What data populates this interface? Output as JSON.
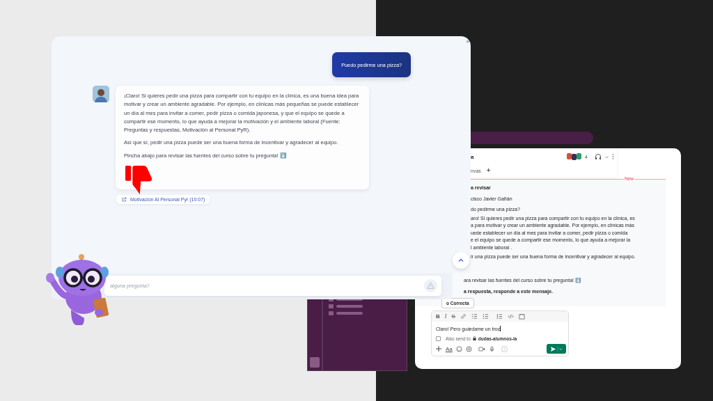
{
  "chat_window": {
    "close": "×",
    "messages": [
      {
        "kind": "user",
        "text": "Puedo pedirme una pizza?"
      },
      {
        "kind": "bot",
        "paragraphs": [
          "¡Claro! Si quieres pedir una pizza para compartir con tu equipo en la clínica, es una buena idea para motivar y crear un ambiente agradable. Por ejemplo, en clínicas más pequeñas se puede establecer un día al mes para invitar a comer, pedir pizza o comida japonesa, y que el equipo se quede a compartir ese momento, lo que ayuda a mejorar la motivación y el ambiente laboral (Fuente: Preguntas y respuestas, Motivación al Personal PyR).",
          "Así que sí, pedir una pizza puede ser una buena forma de incentivar y agradecer al equipo.",
          "Pincha abajo para revisar las fuentes del curso sobre tu pregunta! ⬇️"
        ],
        "source_link": "Motivación Al Personal Pyr (10:07)"
      }
    ],
    "input": {
      "placeholder": "alguna pregunta?"
    }
  },
  "slack_window": {
    "header": {
      "channel": "a",
      "member_count": "4",
      "tab": "nvas",
      "add_tab": "+"
    },
    "new_divider": "New",
    "upper_lines": [
      {
        "text": "a revisar",
        "bold": true
      },
      {
        "text": "cisco Javier Gañán",
        "bold": false
      },
      {
        "text": "do pedirme una pizza?",
        "bold": false
      },
      {
        "text": "aro! Si quieres pedir una pizza para compartir con tu equipo en la clínica, es",
        "bold": false
      },
      {
        "text": "a para motivar y crear un ambiente agradable. Por ejemplo, en clínicas más",
        "bold": false
      },
      {
        "text": "uede establecer un día al mes para invitar a comer, pedir pizza o comida",
        "bold": false
      },
      {
        "text": "e el equipo se quede a compartir ese momento, lo que ayuda a mejorar la",
        "bold": false
      },
      {
        "text": "l ambiente laboral .",
        "bold": false
      },
      {
        "text": "ir una pizza puede ser una buena forma de incentivar y agradecer al equipo.",
        "bold": false
      }
    ],
    "lower_lines": [
      {
        "text": "ara revisar las fuentes del curso sobre tu pregunta! ⬇️",
        "bold": false
      },
      {
        "text": "a respuesta, responde a este mensaje.",
        "bold": true
      }
    ],
    "mark_button": "o Correcta",
    "composer": {
      "format_buttons": [
        "B",
        "I",
        "S"
      ],
      "value": "Claro! Pero guárdame un troc",
      "also_send": {
        "label": "Also send to",
        "channel": "dudas-alumnos-ia",
        "checked": false
      },
      "text_style": "Aa"
    }
  }
}
